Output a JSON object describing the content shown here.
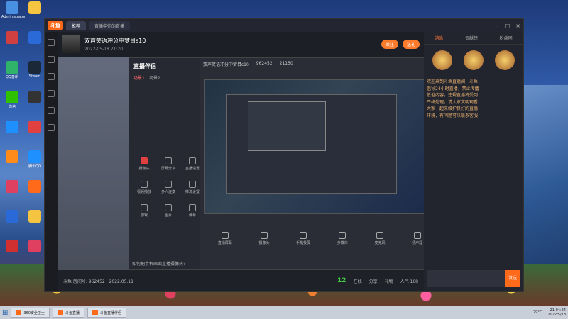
{
  "desktop": {
    "icons": [
      {
        "label": "Administrator",
        "color": "#4a90e2"
      },
      {
        "label": "",
        "color": "#f5c542"
      },
      {
        "label": "",
        "color": "#d04040"
      },
      {
        "label": "",
        "color": "#2a6ad8"
      },
      {
        "label": "QQ音乐",
        "color": "#2fb36b"
      },
      {
        "label": "Steam",
        "color": "#1b2838"
      },
      {
        "label": "微信",
        "color": "#2dc100"
      },
      {
        "label": "",
        "color": "#333"
      },
      {
        "label": "",
        "color": "#1e90ff"
      },
      {
        "label": "",
        "color": "#e04040"
      },
      {
        "label": "",
        "color": "#ff8c1a"
      },
      {
        "label": "腾讯QQ",
        "color": "#1e90ff"
      },
      {
        "label": "",
        "color": "#e04060"
      },
      {
        "label": "",
        "color": "#ff6a1a"
      },
      {
        "label": "",
        "color": "#2a6ad8"
      },
      {
        "label": "",
        "color": "#f5c542"
      },
      {
        "label": "",
        "color": "#d03030"
      },
      {
        "label": "",
        "color": "#e04060"
      }
    ]
  },
  "app": {
    "logo": "斗鱼",
    "tabs": [
      "推荐",
      "直播中你的直播"
    ],
    "room": {
      "title": "双声笑语冲分中梦目s10",
      "meta": "2022-05-18 21:20",
      "follow_label": "关注",
      "gift_label": "送礼"
    },
    "companion": {
      "brand": "直播伴侣",
      "tabs": [
        "场景1",
        "场景2"
      ],
      "header": "双声笑语冲分中梦目s10",
      "stats": [
        "962452",
        "21150"
      ],
      "tools": [
        {
          "label": "摄像头",
          "red": true
        },
        {
          "label": "屏幕分享",
          "red": false
        },
        {
          "label": "直播设置",
          "red": false
        },
        {
          "label": "视频播放",
          "red": false
        },
        {
          "label": "多人连麦",
          "red": false
        },
        {
          "label": "推流设置",
          "red": false
        },
        {
          "label": "游戏",
          "red": false
        },
        {
          "label": "图片",
          "red": false
        },
        {
          "label": "弹幕",
          "red": false
        }
      ],
      "toolbar": [
        "直播屏幕",
        "摄像头",
        "手机投屏",
        "多媒体",
        "麦克风",
        "扬声器"
      ],
      "status": "如何把手机画面直播摄像头?"
    },
    "bottombar": {
      "text": "斗鱼  房间号: 962452 | 2022.05.11",
      "count": "12",
      "count_label": "在线",
      "items": [
        "分享",
        "礼物",
        "人气 168"
      ]
    },
    "chat": {
      "tabs": [
        "消息",
        "贡献榜",
        "粉丝团"
      ],
      "messages": [
        "欢迎来到斗鱼直播间，斗鱼",
        "倡导24小时直播，禁止传播",
        "低俗内容，违规直播将受到",
        "严格处理，请大家文明观看",
        "大家一起来维护良好的直播",
        "环境，有问题可以联系客服"
      ],
      "send_label": "发送"
    }
  },
  "taskbar": {
    "items": [
      "360安全卫士",
      "斗鱼直播",
      "斗鱼直播伴侣"
    ],
    "temp": "29°C",
    "time": "21:04:24",
    "date": "2022/5/18"
  }
}
